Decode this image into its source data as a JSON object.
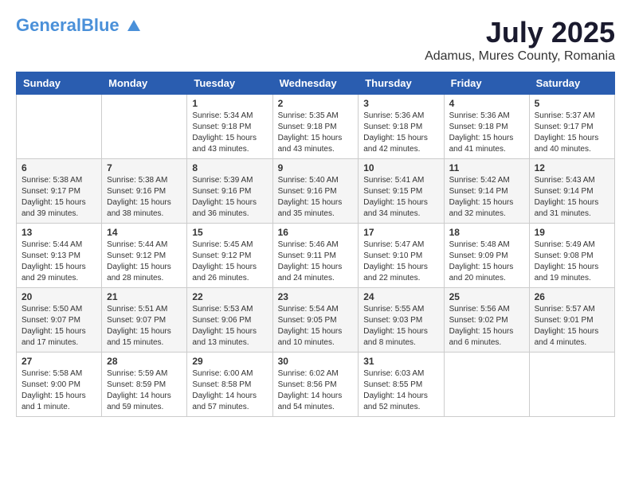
{
  "header": {
    "logo_general": "General",
    "logo_blue": "Blue",
    "month_year": "July 2025",
    "location": "Adamus, Mures County, Romania"
  },
  "weekdays": [
    "Sunday",
    "Monday",
    "Tuesday",
    "Wednesday",
    "Thursday",
    "Friday",
    "Saturday"
  ],
  "weeks": [
    [
      {
        "day": "",
        "info": ""
      },
      {
        "day": "",
        "info": ""
      },
      {
        "day": "1",
        "info": "Sunrise: 5:34 AM\nSunset: 9:18 PM\nDaylight: 15 hours\nand 43 minutes."
      },
      {
        "day": "2",
        "info": "Sunrise: 5:35 AM\nSunset: 9:18 PM\nDaylight: 15 hours\nand 43 minutes."
      },
      {
        "day": "3",
        "info": "Sunrise: 5:36 AM\nSunset: 9:18 PM\nDaylight: 15 hours\nand 42 minutes."
      },
      {
        "day": "4",
        "info": "Sunrise: 5:36 AM\nSunset: 9:18 PM\nDaylight: 15 hours\nand 41 minutes."
      },
      {
        "day": "5",
        "info": "Sunrise: 5:37 AM\nSunset: 9:17 PM\nDaylight: 15 hours\nand 40 minutes."
      }
    ],
    [
      {
        "day": "6",
        "info": "Sunrise: 5:38 AM\nSunset: 9:17 PM\nDaylight: 15 hours\nand 39 minutes."
      },
      {
        "day": "7",
        "info": "Sunrise: 5:38 AM\nSunset: 9:16 PM\nDaylight: 15 hours\nand 38 minutes."
      },
      {
        "day": "8",
        "info": "Sunrise: 5:39 AM\nSunset: 9:16 PM\nDaylight: 15 hours\nand 36 minutes."
      },
      {
        "day": "9",
        "info": "Sunrise: 5:40 AM\nSunset: 9:16 PM\nDaylight: 15 hours\nand 35 minutes."
      },
      {
        "day": "10",
        "info": "Sunrise: 5:41 AM\nSunset: 9:15 PM\nDaylight: 15 hours\nand 34 minutes."
      },
      {
        "day": "11",
        "info": "Sunrise: 5:42 AM\nSunset: 9:14 PM\nDaylight: 15 hours\nand 32 minutes."
      },
      {
        "day": "12",
        "info": "Sunrise: 5:43 AM\nSunset: 9:14 PM\nDaylight: 15 hours\nand 31 minutes."
      }
    ],
    [
      {
        "day": "13",
        "info": "Sunrise: 5:44 AM\nSunset: 9:13 PM\nDaylight: 15 hours\nand 29 minutes."
      },
      {
        "day": "14",
        "info": "Sunrise: 5:44 AM\nSunset: 9:12 PM\nDaylight: 15 hours\nand 28 minutes."
      },
      {
        "day": "15",
        "info": "Sunrise: 5:45 AM\nSunset: 9:12 PM\nDaylight: 15 hours\nand 26 minutes."
      },
      {
        "day": "16",
        "info": "Sunrise: 5:46 AM\nSunset: 9:11 PM\nDaylight: 15 hours\nand 24 minutes."
      },
      {
        "day": "17",
        "info": "Sunrise: 5:47 AM\nSunset: 9:10 PM\nDaylight: 15 hours\nand 22 minutes."
      },
      {
        "day": "18",
        "info": "Sunrise: 5:48 AM\nSunset: 9:09 PM\nDaylight: 15 hours\nand 20 minutes."
      },
      {
        "day": "19",
        "info": "Sunrise: 5:49 AM\nSunset: 9:08 PM\nDaylight: 15 hours\nand 19 minutes."
      }
    ],
    [
      {
        "day": "20",
        "info": "Sunrise: 5:50 AM\nSunset: 9:07 PM\nDaylight: 15 hours\nand 17 minutes."
      },
      {
        "day": "21",
        "info": "Sunrise: 5:51 AM\nSunset: 9:07 PM\nDaylight: 15 hours\nand 15 minutes."
      },
      {
        "day": "22",
        "info": "Sunrise: 5:53 AM\nSunset: 9:06 PM\nDaylight: 15 hours\nand 13 minutes."
      },
      {
        "day": "23",
        "info": "Sunrise: 5:54 AM\nSunset: 9:05 PM\nDaylight: 15 hours\nand 10 minutes."
      },
      {
        "day": "24",
        "info": "Sunrise: 5:55 AM\nSunset: 9:03 PM\nDaylight: 15 hours\nand 8 minutes."
      },
      {
        "day": "25",
        "info": "Sunrise: 5:56 AM\nSunset: 9:02 PM\nDaylight: 15 hours\nand 6 minutes."
      },
      {
        "day": "26",
        "info": "Sunrise: 5:57 AM\nSunset: 9:01 PM\nDaylight: 15 hours\nand 4 minutes."
      }
    ],
    [
      {
        "day": "27",
        "info": "Sunrise: 5:58 AM\nSunset: 9:00 PM\nDaylight: 15 hours\nand 1 minute."
      },
      {
        "day": "28",
        "info": "Sunrise: 5:59 AM\nSunset: 8:59 PM\nDaylight: 14 hours\nand 59 minutes."
      },
      {
        "day": "29",
        "info": "Sunrise: 6:00 AM\nSunset: 8:58 PM\nDaylight: 14 hours\nand 57 minutes."
      },
      {
        "day": "30",
        "info": "Sunrise: 6:02 AM\nSunset: 8:56 PM\nDaylight: 14 hours\nand 54 minutes."
      },
      {
        "day": "31",
        "info": "Sunrise: 6:03 AM\nSunset: 8:55 PM\nDaylight: 14 hours\nand 52 minutes."
      },
      {
        "day": "",
        "info": ""
      },
      {
        "day": "",
        "info": ""
      }
    ]
  ]
}
